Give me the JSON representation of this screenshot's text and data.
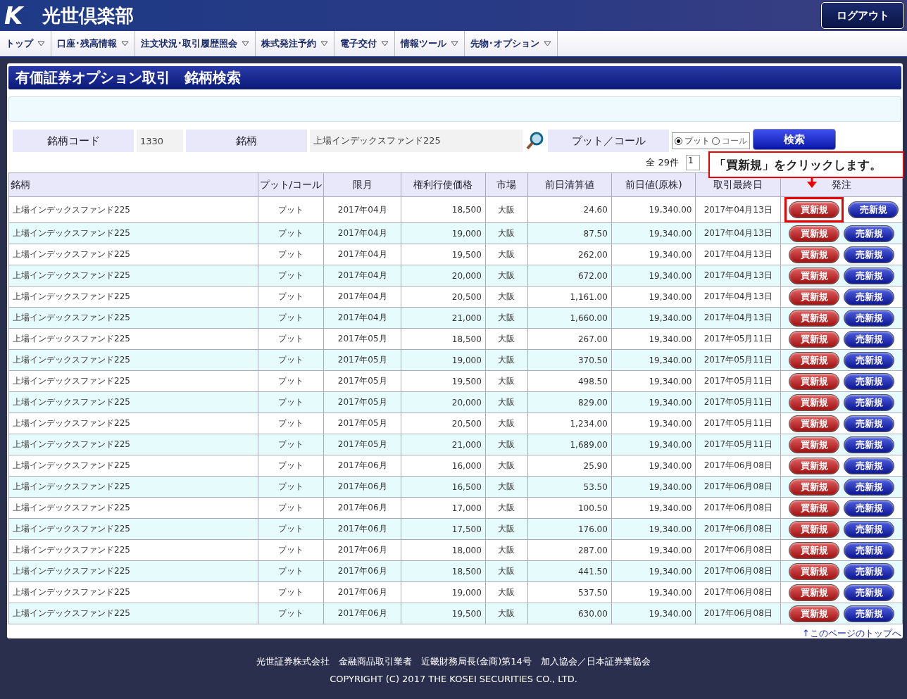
{
  "header": {
    "logo_mark": "K",
    "site_name": "光世倶楽部",
    "logout_button": "ログアウト"
  },
  "nav": [
    "トップ",
    "口座･残高情報",
    "注文状況･取引履歴照会",
    "株式発注予約",
    "電子交付",
    "情報ツール",
    "先物･オプション"
  ],
  "page_title": "有価証券オプション取引　銘柄検索",
  "search": {
    "code_label": "銘柄コード",
    "code_value": "1330",
    "name_label": "銘柄",
    "name_value": "上場インデックスファンド225",
    "putcall_label": "プット／コール",
    "options": [
      {
        "label": "プット",
        "selected": true
      },
      {
        "label": "コール",
        "selected": false
      }
    ],
    "search_button": "検索"
  },
  "result_count": "全 29件",
  "page_value": "1",
  "callout": "「買新規」をクリックします。",
  "table": {
    "columns": [
      "銘柄",
      "プット/コール",
      "限月",
      "権利行使価格",
      "市場",
      "前日清算値",
      "前日値(原株)",
      "取引最終日",
      "発注"
    ],
    "rows": [
      {
        "cells": [
          "上場インデックスファンド225",
          "プット",
          "2017年04月",
          "18,500",
          "大阪",
          "24.60",
          "19,340.00",
          "2017年04月13日"
        ],
        "buy": "買新規",
        "sell": "売新規",
        "highlighted": true
      },
      {
        "cells": [
          "上場インデックスファンド225",
          "プット",
          "2017年04月",
          "19,000",
          "大阪",
          "87.50",
          "19,340.00",
          "2017年04月13日"
        ],
        "buy": "買新規",
        "sell": "売新規",
        "highlighted": false
      },
      {
        "cells": [
          "上場インデックスファンド225",
          "プット",
          "2017年04月",
          "19,500",
          "大阪",
          "262.00",
          "19,340.00",
          "2017年04月13日"
        ],
        "buy": "買新規",
        "sell": "売新規",
        "highlighted": false
      },
      {
        "cells": [
          "上場インデックスファンド225",
          "プット",
          "2017年04月",
          "20,000",
          "大阪",
          "672.00",
          "19,340.00",
          "2017年04月13日"
        ],
        "buy": "買新規",
        "sell": "売新規",
        "highlighted": false
      },
      {
        "cells": [
          "上場インデックスファンド225",
          "プット",
          "2017年04月",
          "20,500",
          "大阪",
          "1,161.00",
          "19,340.00",
          "2017年04月13日"
        ],
        "buy": "買新規",
        "sell": "売新規",
        "highlighted": false
      },
      {
        "cells": [
          "上場インデックスファンド225",
          "プット",
          "2017年04月",
          "21,000",
          "大阪",
          "1,660.00",
          "19,340.00",
          "2017年04月13日"
        ],
        "buy": "買新規",
        "sell": "売新規",
        "highlighted": false
      },
      {
        "cells": [
          "上場インデックスファンド225",
          "プット",
          "2017年05月",
          "18,500",
          "大阪",
          "267.00",
          "19,340.00",
          "2017年05月11日"
        ],
        "buy": "買新規",
        "sell": "売新規",
        "highlighted": false
      },
      {
        "cells": [
          "上場インデックスファンド225",
          "プット",
          "2017年05月",
          "19,000",
          "大阪",
          "370.50",
          "19,340.00",
          "2017年05月11日"
        ],
        "buy": "買新規",
        "sell": "売新規",
        "highlighted": false
      },
      {
        "cells": [
          "上場インデックスファンド225",
          "プット",
          "2017年05月",
          "19,500",
          "大阪",
          "498.50",
          "19,340.00",
          "2017年05月11日"
        ],
        "buy": "買新規",
        "sell": "売新規",
        "highlighted": false
      },
      {
        "cells": [
          "上場インデックスファンド225",
          "プット",
          "2017年05月",
          "20,000",
          "大阪",
          "829.00",
          "19,340.00",
          "2017年05月11日"
        ],
        "buy": "買新規",
        "sell": "売新規",
        "highlighted": false
      },
      {
        "cells": [
          "上場インデックスファンド225",
          "プット",
          "2017年05月",
          "20,500",
          "大阪",
          "1,234.00",
          "19,340.00",
          "2017年05月11日"
        ],
        "buy": "買新規",
        "sell": "売新規",
        "highlighted": false
      },
      {
        "cells": [
          "上場インデックスファンド225",
          "プット",
          "2017年05月",
          "21,000",
          "大阪",
          "1,689.00",
          "19,340.00",
          "2017年05月11日"
        ],
        "buy": "買新規",
        "sell": "売新規",
        "highlighted": false
      },
      {
        "cells": [
          "上場インデックスファンド225",
          "プット",
          "2017年06月",
          "16,000",
          "大阪",
          "25.90",
          "19,340.00",
          "2017年06月08日"
        ],
        "buy": "買新規",
        "sell": "売新規",
        "highlighted": false
      },
      {
        "cells": [
          "上場インデックスファンド225",
          "プット",
          "2017年06月",
          "16,500",
          "大阪",
          "53.50",
          "19,340.00",
          "2017年06月08日"
        ],
        "buy": "買新規",
        "sell": "売新規",
        "highlighted": false
      },
      {
        "cells": [
          "上場インデックスファンド225",
          "プット",
          "2017年06月",
          "17,000",
          "大阪",
          "100.50",
          "19,340.00",
          "2017年06月08日"
        ],
        "buy": "買新規",
        "sell": "売新規",
        "highlighted": false
      },
      {
        "cells": [
          "上場インデックスファンド225",
          "プット",
          "2017年06月",
          "17,500",
          "大阪",
          "176.00",
          "19,340.00",
          "2017年06月08日"
        ],
        "buy": "買新規",
        "sell": "売新規",
        "highlighted": false
      },
      {
        "cells": [
          "上場インデックスファンド225",
          "プット",
          "2017年06月",
          "18,000",
          "大阪",
          "287.00",
          "19,340.00",
          "2017年06月08日"
        ],
        "buy": "買新規",
        "sell": "売新規",
        "highlighted": false
      },
      {
        "cells": [
          "上場インデックスファンド225",
          "プット",
          "2017年06月",
          "18,500",
          "大阪",
          "441.50",
          "19,340.00",
          "2017年06月08日"
        ],
        "buy": "買新規",
        "sell": "売新規",
        "highlighted": false
      },
      {
        "cells": [
          "上場インデックスファンド225",
          "プット",
          "2017年06月",
          "19,000",
          "大阪",
          "537.50",
          "19,340.00",
          "2017年06月08日"
        ],
        "buy": "買新規",
        "sell": "売新規",
        "highlighted": false
      },
      {
        "cells": [
          "上場インデックスファンド225",
          "プット",
          "2017年06月",
          "19,500",
          "大阪",
          "630.00",
          "19,340.00",
          "2017年06月08日"
        ],
        "buy": "買新規",
        "sell": "売新規",
        "highlighted": false
      }
    ]
  },
  "page_top_link": "↑このページのトップへ",
  "footer": {
    "company": "光世証券株式会社　金融商品取引業者　近畿財務局長(金商)第14号　加入協会／日本証券業協会",
    "copyright": "COPYRIGHT (C) 2017 THE KOSEI SECURITIES CO., LTD."
  }
}
